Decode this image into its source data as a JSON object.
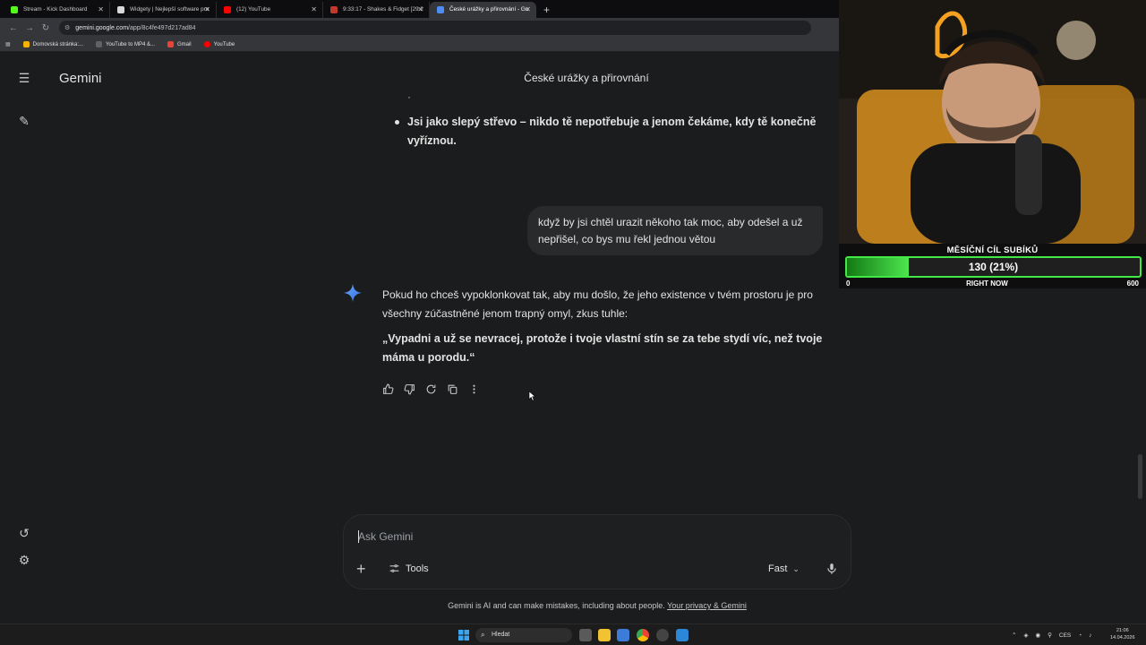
{
  "browser": {
    "tabs": [
      {
        "label": "Stream - Kick Dashboard",
        "favicon_color": "#53fc18",
        "active": false
      },
      {
        "label": "Widgety | Nejlepší software pro",
        "favicon_color": "#d9d9d9",
        "active": false
      },
      {
        "label": "(12) YouTube",
        "favicon_color": "#ff0000",
        "active": false
      },
      {
        "label": "9:33:17 - Shakes & Fidget [29.2",
        "favicon_color": "#c0392b",
        "active": false
      },
      {
        "label": "České urážky a přirovnání - Go",
        "favicon_color": "#4e8cf7",
        "active": true
      }
    ],
    "new_tab": "+",
    "url_host": "gemini.google.com",
    "url_path": "/app/8c4fe497d217ad84",
    "bookmarks": [
      {
        "label": "Domovská stránka:...",
        "color": "#f4b400"
      },
      {
        "label": "YouTube to MP4 &...",
        "color": "#5f6368"
      },
      {
        "label": "Gmail",
        "color": "#ea4335"
      },
      {
        "label": "YouTube",
        "color": "#ff0000"
      }
    ]
  },
  "gemini": {
    "brand": "Gemini",
    "chat_title": "České urážky a přirovnání",
    "previous_bullet": "Jsi jako slepý střevo – nikdo tě nepotřebuje a jenom čekáme, kdy tě konečně vyříznou.",
    "user_message": "když by jsi chtěl urazit někoho tak moc, aby odešel a už nepřišel, co bys mu řekl jednou větou",
    "response_intro": "Pokud ho chceš vypoklonkovat tak, aby mu došlo, že jeho existence v tvém prostoru je pro všechny zúčastněné jenom trapný omyl, zkus tuhle:",
    "response_quote": "„Vypadni a už se nevracej, protože i tvoje vlastní stín se za tebe stydí víc, než tvoje máma u porodu.“",
    "input_placeholder": "Ask Gemini",
    "tools_label": "Tools",
    "mode_label": "Fast",
    "disclaimer": "Gemini is AI and can make mistakes, including about people.",
    "privacy_link": "Your privacy & Gemini"
  },
  "overlay": {
    "goal_title": "MĚSÍČNÍ CÍL SUBÍKŮ",
    "goal_value_text": "130 (21%)",
    "goal_fraction": 0.21,
    "goal_min": "0",
    "goal_max": "600",
    "goal_now": "RIGHT NOW"
  },
  "taskbar": {
    "search_label": "Hledat",
    "lang": "CES",
    "time": "21:06",
    "date": "14.04.2026"
  },
  "colors": {
    "accent_green": "#42e845",
    "gemini_blue": "#4e8cf7",
    "page_bg": "#1b1c1d"
  }
}
